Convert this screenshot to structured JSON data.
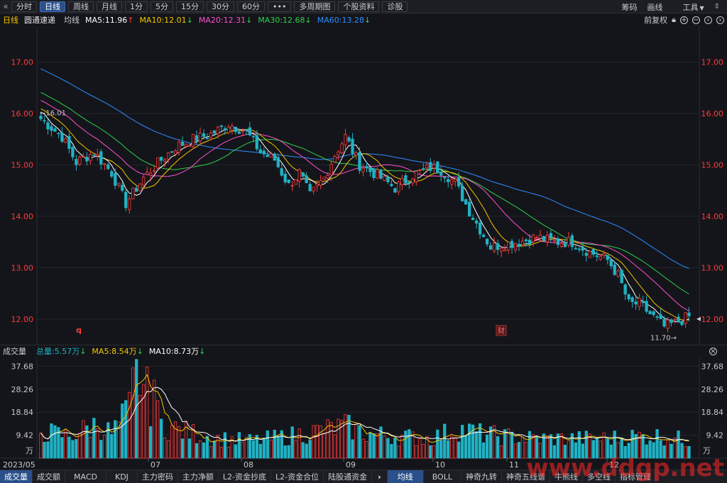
{
  "toolbar": {
    "back_icon": "«",
    "periods": [
      "分时",
      "日线",
      "周线",
      "月线",
      "1分",
      "5分",
      "15分",
      "30分",
      "60分",
      "•••",
      "多周期图",
      "个股资料",
      "诊股"
    ],
    "active_period": "日线",
    "right": {
      "chouma": "筹码",
      "huaxian": "画线",
      "gongju": "工具"
    }
  },
  "info": {
    "period": "日线",
    "stock_name": "圆通速递",
    "ma_label": "均线",
    "ma5": "MA5:11.96",
    "ma10": "MA10:12.01",
    "ma20": "MA20:12.31",
    "ma30": "MA30:12.68",
    "ma60": "MA60:13.28",
    "fq": "前复权"
  },
  "colors": {
    "up": "#ff3b3b",
    "down": "#20b2c4",
    "ma5": "#ffffff",
    "ma10": "#f5c400",
    "ma20": "#ff4fd0",
    "ma30": "#2fd14a",
    "ma60": "#2c8cff",
    "price_axis": "#ff3b3b"
  },
  "volume": {
    "label": "成交量",
    "total": "总量:5.57万",
    "ma5": "MA5:8.54万",
    "ma10": "MA10:8.73万",
    "unit": "万"
  },
  "marks": {
    "high": "16.01",
    "low": "11.70",
    "q": "q",
    "cai": "财"
  },
  "bottom_tabs_left": [
    "成交量",
    "成交额",
    "MACD",
    "KDJ",
    "主力密码",
    "主力净额",
    "L2-资金抄底",
    "L2-资金合位",
    "陆股通资金"
  ],
  "bottom_sep": "›",
  "bottom_tabs_right": [
    "均线",
    "BOLL",
    "神奇九转",
    "神奇五线谱",
    "牛熊线",
    "多空线",
    "指标管理"
  ],
  "watermark": "www.ddgp.net",
  "chart_data": {
    "type": "candlestick",
    "ylim": [
      11.5,
      17.7
    ],
    "yticks": [
      "17.00",
      "16.00",
      "15.00",
      "14.00",
      "13.00",
      "12.00"
    ],
    "vol_ticks": [
      "37.68",
      "28.26",
      "18.84",
      "9.42"
    ],
    "vol_ylim": [
      0,
      41
    ],
    "x_labels": [
      "2023/05",
      "07",
      "08",
      "09",
      "10",
      "11",
      "12"
    ],
    "anchors": [
      [
        0,
        15.9
      ],
      [
        6,
        15.55
      ],
      [
        10,
        15.05
      ],
      [
        15,
        15.25
      ],
      [
        20,
        14.85
      ],
      [
        24,
        14.25
      ],
      [
        26,
        14.45
      ],
      [
        29,
        14.75
      ],
      [
        34,
        15.1
      ],
      [
        38,
        15.35
      ],
      [
        43,
        15.5
      ],
      [
        48,
        15.6
      ],
      [
        53,
        15.8
      ],
      [
        58,
        15.65
      ],
      [
        62,
        15.25
      ],
      [
        66,
        15.1
      ],
      [
        70,
        14.6
      ],
      [
        73,
        14.85
      ],
      [
        76,
        14.4
      ],
      [
        80,
        14.75
      ],
      [
        83,
        15.2
      ],
      [
        86,
        15.55
      ],
      [
        90,
        15.0
      ],
      [
        95,
        14.8
      ],
      [
        100,
        14.55
      ],
      [
        105,
        14.8
      ],
      [
        110,
        14.95
      ],
      [
        113,
        14.9
      ],
      [
        117,
        14.65
      ],
      [
        121,
        14.1
      ],
      [
        124,
        13.75
      ],
      [
        127,
        13.4
      ],
      [
        130,
        13.45
      ],
      [
        135,
        13.5
      ],
      [
        140,
        13.6
      ],
      [
        145,
        13.5
      ],
      [
        150,
        13.5
      ],
      [
        155,
        13.3
      ],
      [
        160,
        13.15
      ],
      [
        163,
        12.85
      ],
      [
        166,
        12.3
      ],
      [
        169,
        12.3
      ],
      [
        172,
        12.1
      ],
      [
        176,
        11.85
      ],
      [
        180,
        11.95
      ],
      [
        183,
        12.05
      ]
    ],
    "vol_anchors": [
      [
        0,
        11
      ],
      [
        8,
        9
      ],
      [
        16,
        14
      ],
      [
        20,
        10
      ],
      [
        25,
        20
      ],
      [
        27,
        38
      ],
      [
        30,
        26
      ],
      [
        34,
        14
      ],
      [
        40,
        11
      ],
      [
        50,
        8
      ],
      [
        60,
        7
      ],
      [
        70,
        9
      ],
      [
        78,
        11
      ],
      [
        86,
        13
      ],
      [
        92,
        10
      ],
      [
        100,
        9
      ],
      [
        110,
        8
      ],
      [
        118,
        12
      ],
      [
        124,
        10
      ],
      [
        130,
        9
      ],
      [
        140,
        8
      ],
      [
        150,
        8
      ],
      [
        160,
        8
      ],
      [
        168,
        9
      ],
      [
        176,
        9
      ],
      [
        183,
        7
      ]
    ]
  }
}
